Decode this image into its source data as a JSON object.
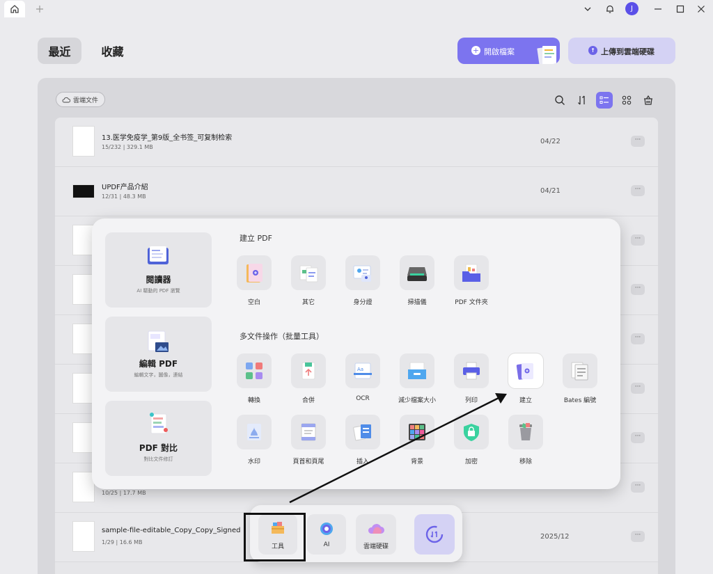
{
  "titlebar": {
    "avatar_letter": "J"
  },
  "nav": {
    "recent": "最近",
    "favorites": "收藏"
  },
  "actions": {
    "open_file": "開啟檔案",
    "upload_cloud": "上傳到雲端硬碟"
  },
  "panel": {
    "cloud_docs": "雲端文件"
  },
  "files": [
    {
      "name": "13.医学免疫学_第9版_全书签_可复制检索",
      "meta": "15/232 | 329.1 MB",
      "date": "04/22"
    },
    {
      "name": "UPDF产品介紹",
      "meta": "12/31 | 48.3 MB",
      "date": "04/21"
    },
    {
      "name": "",
      "meta": "10/25 | 17.7 MB",
      "date": ""
    },
    {
      "name": "sample-file-editable_Copy_Copy_Signed",
      "meta": "1/29 | 16.6 MB",
      "date": "2025/12"
    }
  ],
  "more_label": "···",
  "popup": {
    "cards": [
      {
        "title": "閱讀器",
        "subtitle": "AI 驅動的 PDF 瀏覽"
      },
      {
        "title": "編輯 PDF",
        "subtitle": "編輯文字，圖像，連結"
      },
      {
        "title": "PDF 對比",
        "subtitle": "對比文件修訂"
      }
    ],
    "create_title": "建立 PDF",
    "create_tools": [
      "空白",
      "其它",
      "身分證",
      "掃描儀",
      "PDF 文件夾"
    ],
    "batch_title": "多文件操作（批量工具）",
    "batch_row1": [
      "轉換",
      "合併",
      "OCR",
      "減少檔案大小",
      "列印",
      "建立",
      "Bates 編號"
    ],
    "batch_row2": [
      "水印",
      "頁首和頁尾",
      "插入",
      "背景",
      "加密",
      "移除"
    ]
  },
  "dock": {
    "tools": "工具",
    "ai": "AI",
    "cloud": "雲端硬碟"
  },
  "colors": {
    "accent": "#7c74ef",
    "accent_light": "#d4d2f4"
  }
}
